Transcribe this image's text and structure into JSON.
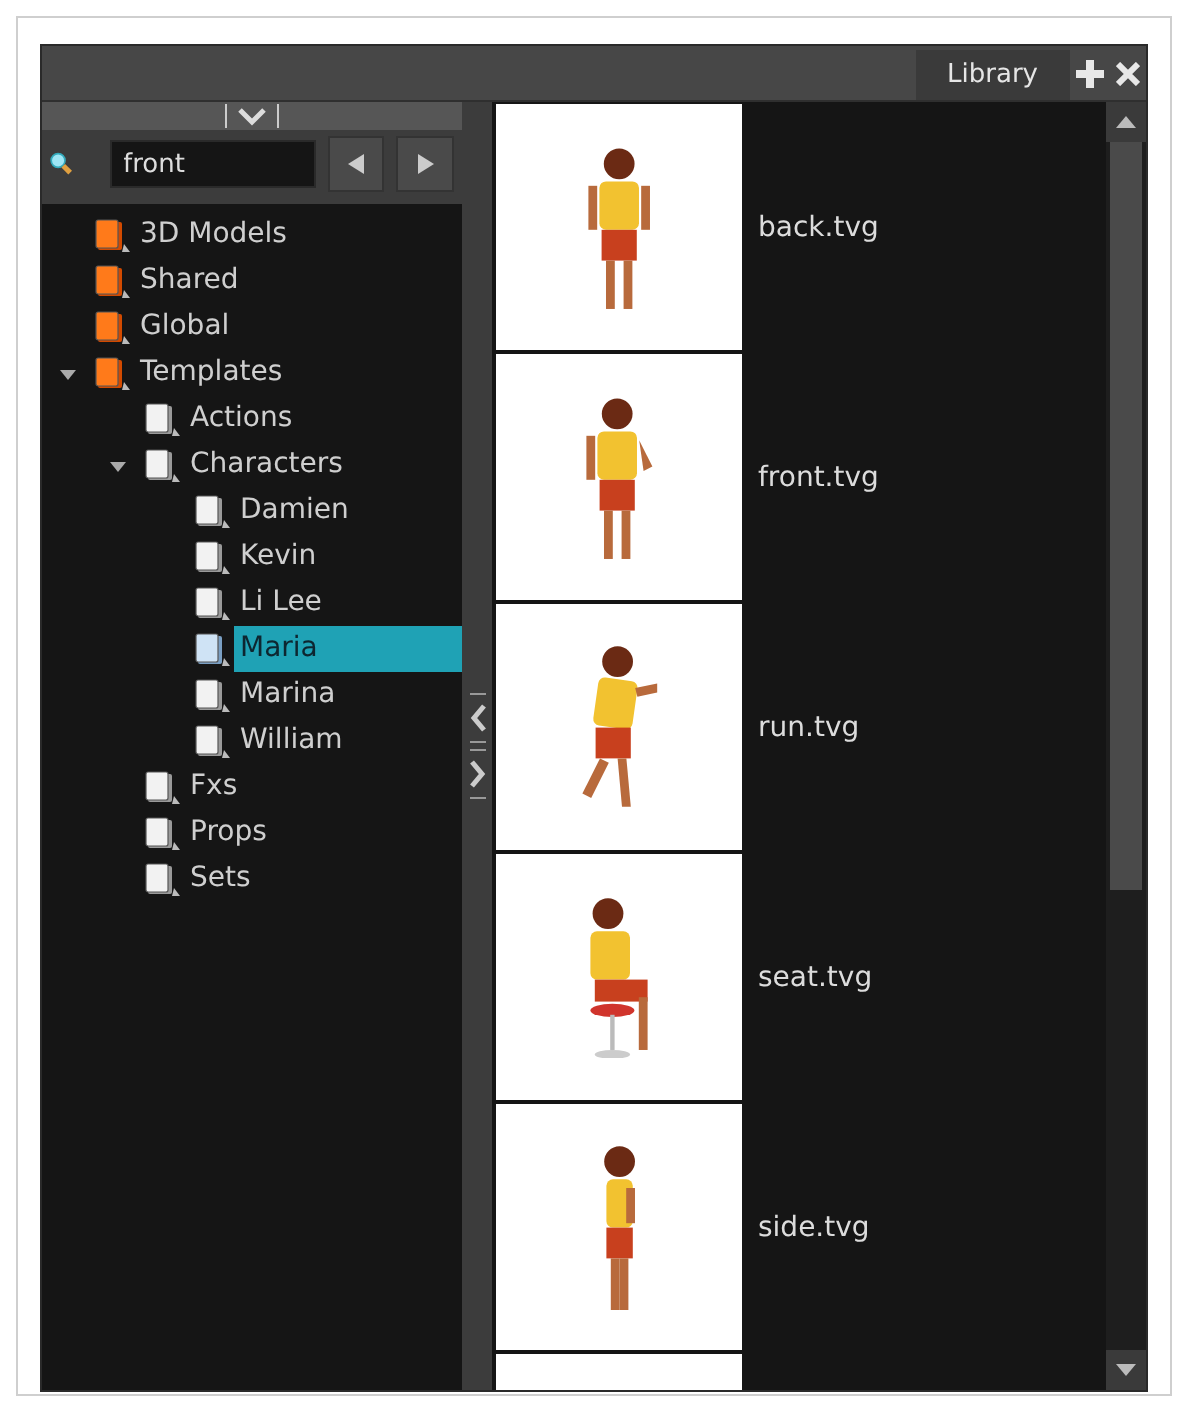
{
  "panel": {
    "tab": "Library"
  },
  "search": {
    "value": "front"
  },
  "tree": [
    {
      "label": "3D Models",
      "kind": "library",
      "selected": false
    },
    {
      "label": "Shared",
      "kind": "library",
      "selected": false
    },
    {
      "label": "Global",
      "kind": "library",
      "selected": false
    },
    {
      "label": "Templates",
      "kind": "library",
      "selected": false,
      "expanded": true,
      "children": [
        {
          "label": "Actions",
          "kind": "folder",
          "selected": false
        },
        {
          "label": "Characters",
          "kind": "folder",
          "selected": false,
          "expanded": true,
          "children": [
            {
              "label": "Damien",
              "kind": "folder",
              "selected": false
            },
            {
              "label": "Kevin",
              "kind": "folder",
              "selected": false
            },
            {
              "label": "Li Lee",
              "kind": "folder",
              "selected": false
            },
            {
              "label": "Maria",
              "kind": "folder",
              "selected": true
            },
            {
              "label": "Marina",
              "kind": "folder",
              "selected": false
            },
            {
              "label": "William",
              "kind": "folder",
              "selected": false
            }
          ]
        },
        {
          "label": "Fxs",
          "kind": "folder",
          "selected": false
        },
        {
          "label": "Props",
          "kind": "folder",
          "selected": false
        },
        {
          "label": "Sets",
          "kind": "folder",
          "selected": false
        }
      ]
    }
  ],
  "templates": [
    {
      "name": "back.tvg"
    },
    {
      "name": "front.tvg"
    },
    {
      "name": "run.tvg"
    },
    {
      "name": "seat.tvg"
    },
    {
      "name": "side.tvg"
    }
  ]
}
